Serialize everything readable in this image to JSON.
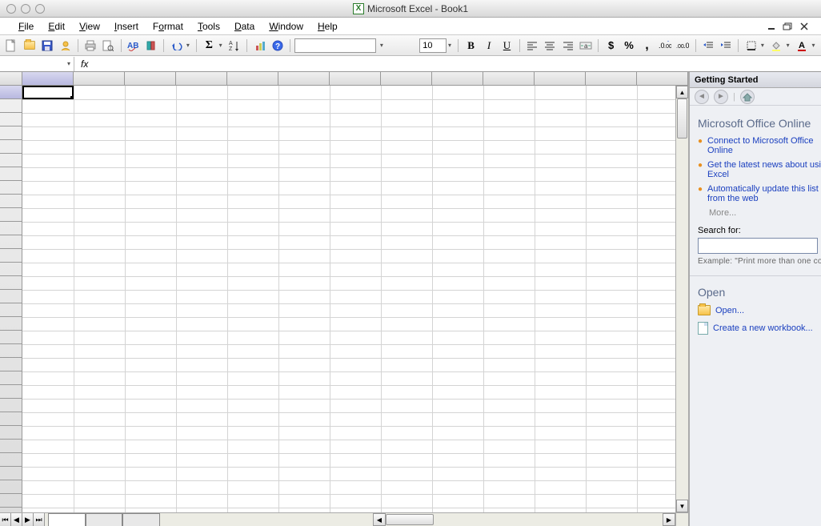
{
  "title": "Microsoft Excel - Book1",
  "menus": {
    "file": "File",
    "edit": "Edit",
    "view": "View",
    "insert": "Insert",
    "format": "Format",
    "tools": "Tools",
    "data": "Data",
    "window": "Window",
    "help": "Help"
  },
  "toolbar": {
    "font_size": "10"
  },
  "formula": {
    "namebox": "",
    "fx": "fx",
    "value": ""
  },
  "taskpane": {
    "header": "Getting Started",
    "section_online": "Microsoft Office Online",
    "links": {
      "connect": "Connect to Microsoft Office Online",
      "news": "Get the latest news about using Excel",
      "autoupdate": "Automatically update this list from the web"
    },
    "more": "More...",
    "search_label": "Search for:",
    "search_value": "",
    "example": "Example:  \"Print more than one copy\"",
    "open_heading": "Open",
    "open_link": "Open...",
    "new_workbook": "Create a new workbook..."
  }
}
